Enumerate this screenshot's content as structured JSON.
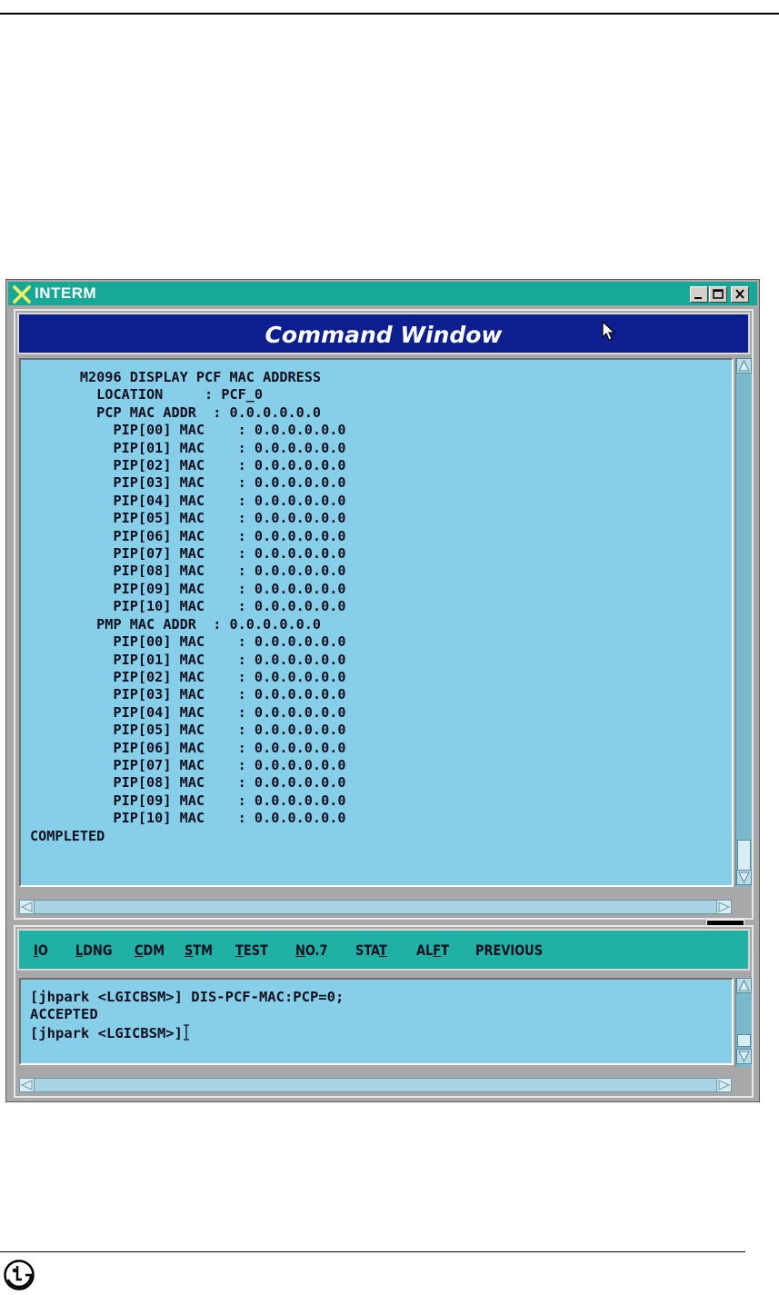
{
  "window": {
    "title": "INTERM"
  },
  "command_window": {
    "title": "Command Window"
  },
  "output_lines": [
    "      M2096 DISPLAY PCF MAC ADDRESS",
    "        LOCATION     : PCF_0",
    "        PCP MAC ADDR  : 0.0.0.0.0.0",
    "          PIP[00] MAC    : 0.0.0.0.0.0",
    "          PIP[01] MAC    : 0.0.0.0.0.0",
    "          PIP[02] MAC    : 0.0.0.0.0.0",
    "          PIP[03] MAC    : 0.0.0.0.0.0",
    "          PIP[04] MAC    : 0.0.0.0.0.0",
    "          PIP[05] MAC    : 0.0.0.0.0.0",
    "          PIP[06] MAC    : 0.0.0.0.0.0",
    "          PIP[07] MAC    : 0.0.0.0.0.0",
    "          PIP[08] MAC    : 0.0.0.0.0.0",
    "          PIP[09] MAC    : 0.0.0.0.0.0",
    "          PIP[10] MAC    : 0.0.0.0.0.0",
    "        PMP MAC ADDR  : 0.0.0.0.0.0",
    "          PIP[00] MAC    : 0.0.0.0.0.0",
    "          PIP[01] MAC    : 0.0.0.0.0.0",
    "          PIP[02] MAC    : 0.0.0.0.0.0",
    "          PIP[03] MAC    : 0.0.0.0.0.0",
    "          PIP[04] MAC    : 0.0.0.0.0.0",
    "          PIP[05] MAC    : 0.0.0.0.0.0",
    "          PIP[06] MAC    : 0.0.0.0.0.0",
    "          PIP[07] MAC    : 0.0.0.0.0.0",
    "          PIP[08] MAC    : 0.0.0.0.0.0",
    "          PIP[09] MAC    : 0.0.0.0.0.0",
    "          PIP[10] MAC    : 0.0.0.0.0.0",
    "COMPLETED"
  ],
  "menu": {
    "items": [
      {
        "label_pre": "",
        "label_u": "I",
        "label_post": "O"
      },
      {
        "label_pre": "",
        "label_u": "L",
        "label_post": "DNG"
      },
      {
        "label_pre": "",
        "label_u": "C",
        "label_post": "DM"
      },
      {
        "label_pre": "",
        "label_u": "S",
        "label_post": "TM"
      },
      {
        "label_pre": "",
        "label_u": "T",
        "label_post": "EST"
      },
      {
        "label_pre": "",
        "label_u": "N",
        "label_post": "O.7"
      },
      {
        "label_pre": "STA",
        "label_u": "T",
        "label_post": ""
      },
      {
        "label_pre": "AL",
        "label_u": "F",
        "label_post": "T"
      },
      {
        "label_pre": "PREVIOUS",
        "label_u": "",
        "label_post": ""
      }
    ]
  },
  "console": {
    "lines": [
      "[jhpark <LGICBSM>] DIS-PCF-MAC:PCP=0;",
      "ACCEPTED"
    ],
    "prompt": "[jhpark <LGICBSM>]"
  },
  "icons": {
    "title_icon": "x-logo-icon",
    "pointer": "mouse-pointer-icon",
    "minimize": "minimize-icon",
    "maximize": "maximize-icon",
    "close": "close-icon",
    "brand": "lg-logo-icon"
  },
  "colors": {
    "titlebar": "#18a898",
    "header": "#0d1f8e",
    "terminal_bg": "#87cfe9",
    "menubar": "#20b0a4"
  }
}
